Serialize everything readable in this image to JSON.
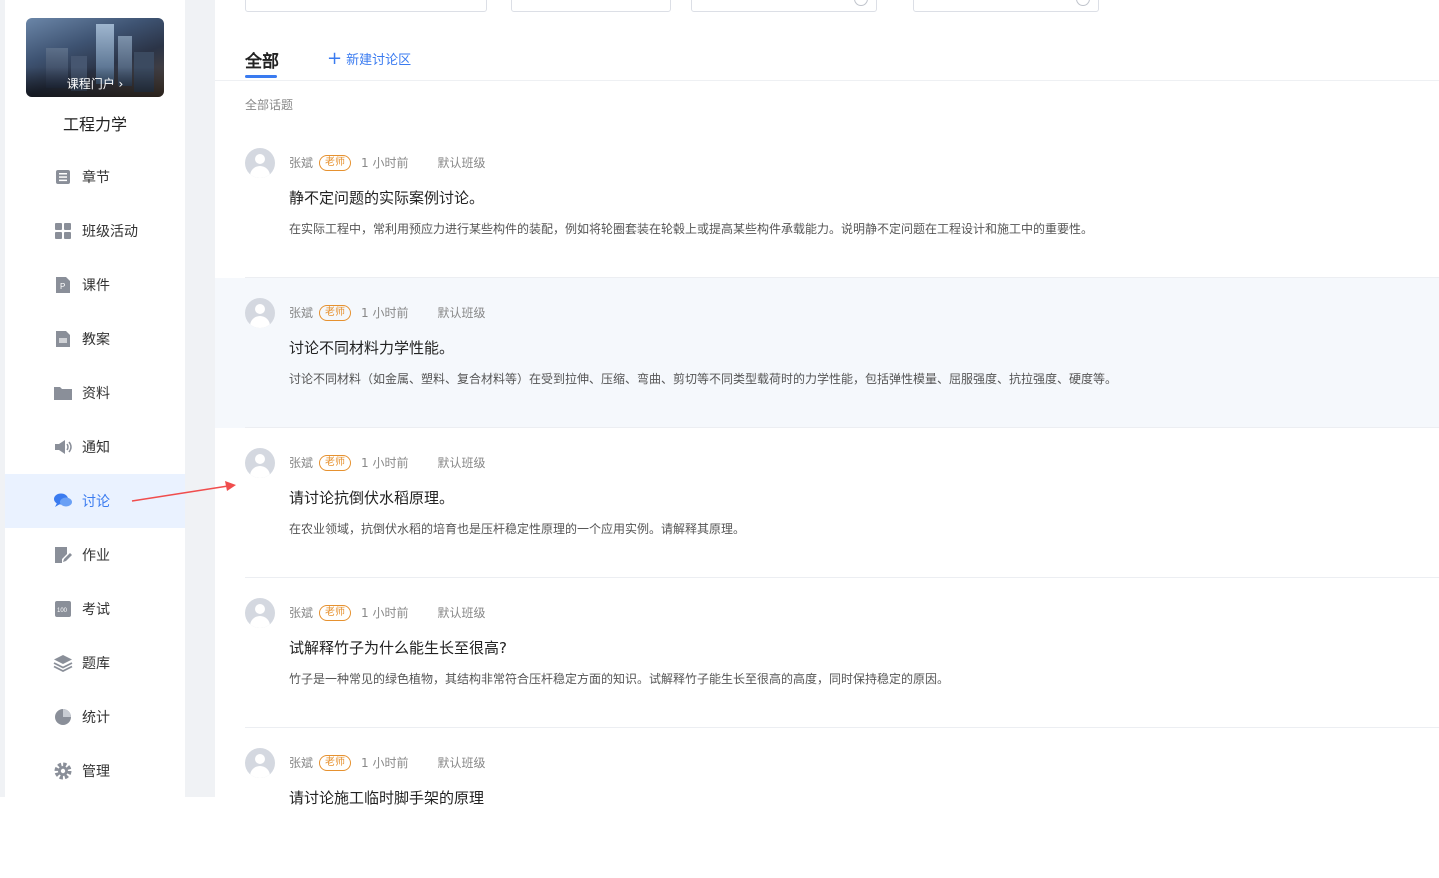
{
  "sidebar": {
    "cover_label": "课程门户 ›",
    "course_title": "工程力学",
    "items": [
      {
        "label": "章节",
        "icon": "list-icon"
      },
      {
        "label": "班级活动",
        "icon": "grid-icon"
      },
      {
        "label": "课件",
        "icon": "ppt-file-icon"
      },
      {
        "label": "教案",
        "icon": "lesson-plan-icon"
      },
      {
        "label": "资料",
        "icon": "folder-icon"
      },
      {
        "label": "通知",
        "icon": "speaker-icon"
      },
      {
        "label": "讨论",
        "icon": "chat-bubbles-icon",
        "active": true
      },
      {
        "label": "作业",
        "icon": "edit-icon"
      },
      {
        "label": "考试",
        "icon": "exam-icon"
      },
      {
        "label": "题库",
        "icon": "layers-icon"
      },
      {
        "label": "统计",
        "icon": "pie-chart-icon"
      },
      {
        "label": "管理",
        "icon": "gear-icon"
      }
    ]
  },
  "main": {
    "tabs": {
      "all": "全部",
      "new_topic": "新建讨论区"
    },
    "section_label": "全部话题",
    "topics": [
      {
        "author": "张斌",
        "role": "老师",
        "time": "1 小时前",
        "class": "默认班级",
        "title": "静不定问题的实际案例讨论。",
        "desc": "在实际工程中，常利用预应力进行某些构件的装配，例如将轮圈套装在轮毂上或提高某些构件承载能力。说明静不定问题在工程设计和施工中的重要性。"
      },
      {
        "author": "张斌",
        "role": "老师",
        "time": "1 小时前",
        "class": "默认班级",
        "title": "讨论不同材料力学性能。",
        "desc": "讨论不同材料（如金属、塑料、复合材料等）在受到拉伸、压缩、弯曲、剪切等不同类型载荷时的力学性能，包括弹性模量、屈服强度、抗拉强度、硬度等。"
      },
      {
        "author": "张斌",
        "role": "老师",
        "time": "1 小时前",
        "class": "默认班级",
        "title": "请讨论抗倒伏水稻原理。",
        "desc": "在农业领域，抗倒伏水稻的培育也是压杆稳定性原理的一个应用实例。请解释其原理。"
      },
      {
        "author": "张斌",
        "role": "老师",
        "time": "1 小时前",
        "class": "默认班级",
        "title": "试解释竹子为什么能生长至很高?",
        "desc": "竹子是一种常见的绿色植物，其结构非常符合压杆稳定方面的知识。试解释竹子能生长至很高的高度，同时保持稳定的原因。"
      },
      {
        "author": "张斌",
        "role": "老师",
        "time": "1 小时前",
        "class": "默认班级",
        "title": "请讨论施工临时脚手架的原理",
        "desc": ""
      }
    ]
  },
  "colors": {
    "accent": "#3a7bf0",
    "badge": "#e6912f",
    "annotation_arrow": "#f04d4d"
  }
}
